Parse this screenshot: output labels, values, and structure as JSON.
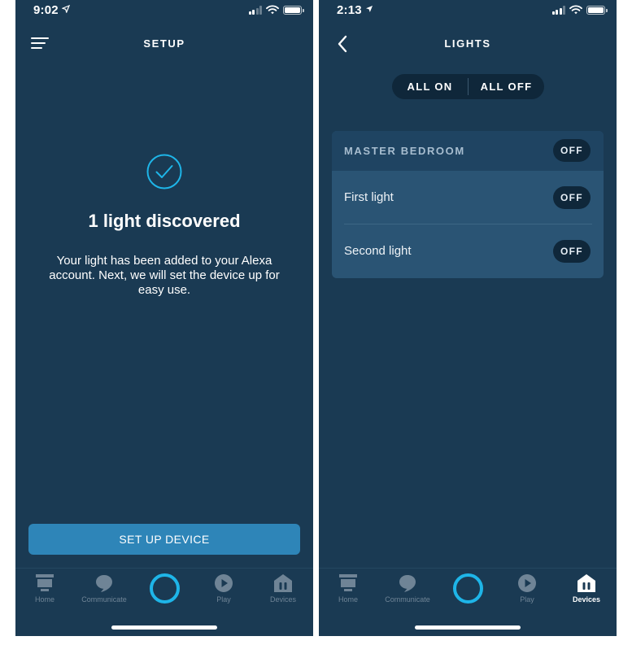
{
  "left": {
    "status": {
      "time": "9:02"
    },
    "header": {
      "title": "SETUP"
    },
    "discovered_title": "1 light discovered",
    "description": "Your light has been added to your Alexa account. Next, we will set the device up for easy use.",
    "setup_button_label": "SET UP DEVICE"
  },
  "right": {
    "status": {
      "time": "2:13"
    },
    "header": {
      "title": "LIGHTS"
    },
    "all_on_label": "ALL ON",
    "all_off_label": "ALL OFF",
    "group": {
      "name": "MASTER BEDROOM",
      "state": "OFF",
      "lights": [
        {
          "name": "First light",
          "state": "OFF"
        },
        {
          "name": "Second light",
          "state": "OFF"
        }
      ]
    }
  },
  "nav": {
    "items": [
      {
        "label": "Home",
        "icon": "home-icon"
      },
      {
        "label": "Communicate",
        "icon": "chat-bubble-icon"
      },
      {
        "label": "",
        "icon": "alexa-icon"
      },
      {
        "label": "Play",
        "icon": "play-icon"
      },
      {
        "label": "Devices",
        "icon": "devices-icon"
      }
    ],
    "active_left": "",
    "active_right": "Devices"
  },
  "colors": {
    "background": "#1a3a53",
    "accent_button": "#2e85b8",
    "alexa_ring": "#1eb5e8",
    "pill": "#0f273a",
    "card": "#2a5474"
  }
}
